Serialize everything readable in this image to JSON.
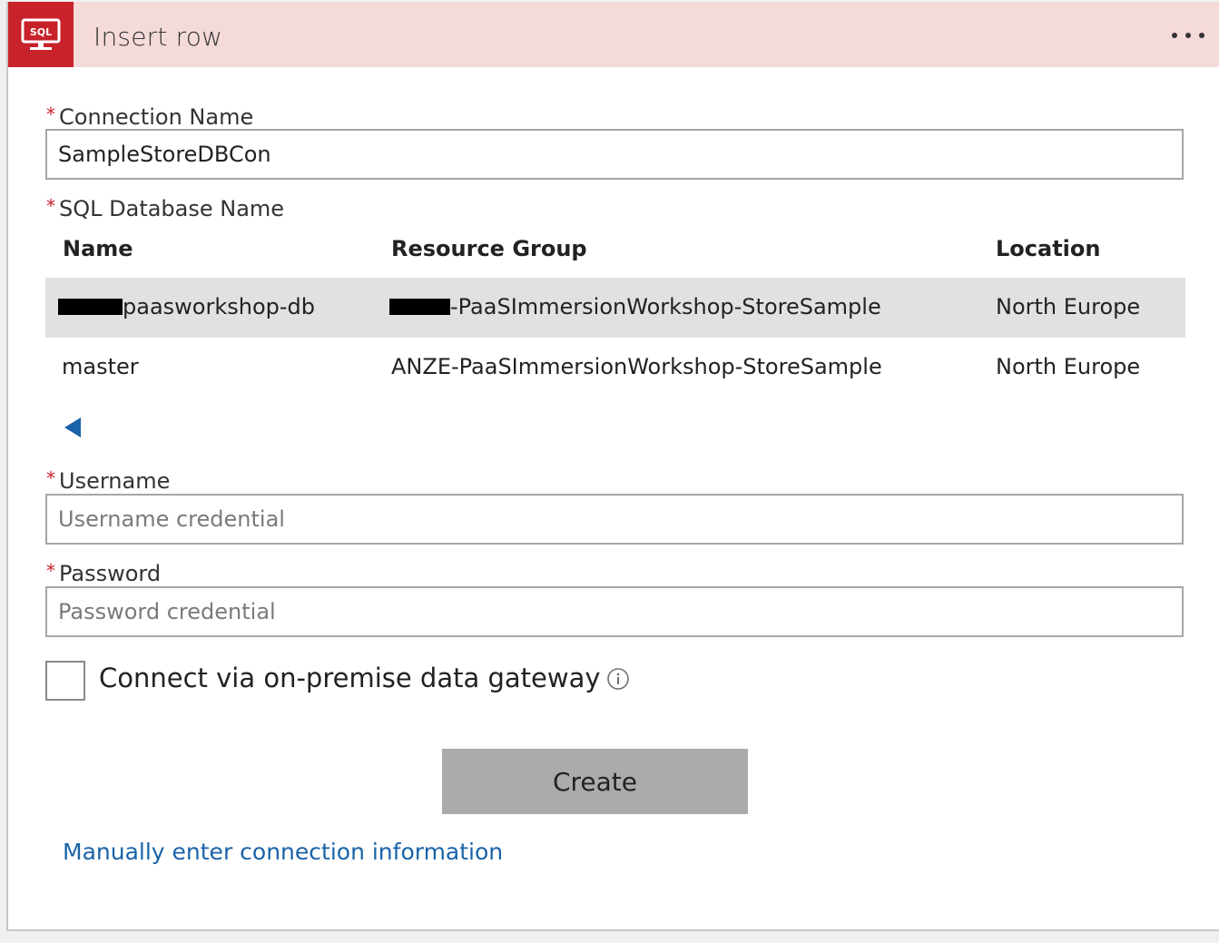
{
  "header": {
    "tile_label": "SQL",
    "title": "Insert row",
    "menu_icon": "more-horizontal-icon"
  },
  "connection_name": {
    "label": "Connection Name",
    "value": "SampleStoreDBCon"
  },
  "database": {
    "label": "SQL Database Name",
    "columns": [
      "Name",
      "Resource Group",
      "Location"
    ],
    "rows": [
      {
        "name": "paasworkshop-db",
        "resource_group": "-PaaSImmersionWorkshop-StoreSample",
        "location": "North Europe",
        "selected": true,
        "redacted": true
      },
      {
        "name": "master",
        "resource_group": "ANZE-PaaSImmersionWorkshop-StoreSample",
        "location": "North Europe",
        "selected": false,
        "redacted": false
      }
    ],
    "back_icon": "triangle-left-icon"
  },
  "username": {
    "label": "Username",
    "placeholder": "Username credential",
    "value": ""
  },
  "password": {
    "label": "Password",
    "placeholder": "Password credential",
    "value": ""
  },
  "gateway": {
    "label": "Connect via on-premise data gateway",
    "checked": false,
    "info_icon": "info-icon"
  },
  "actions": {
    "create_label": "Create",
    "manual_link": "Manually enter connection information"
  },
  "colors": {
    "header_bg": "#f5dada",
    "tile_bg": "#c8222b",
    "required_star": "#c8222b",
    "selected_row": "#e1e1e1",
    "button_bg": "#ababab",
    "link": "#1a63a8"
  }
}
